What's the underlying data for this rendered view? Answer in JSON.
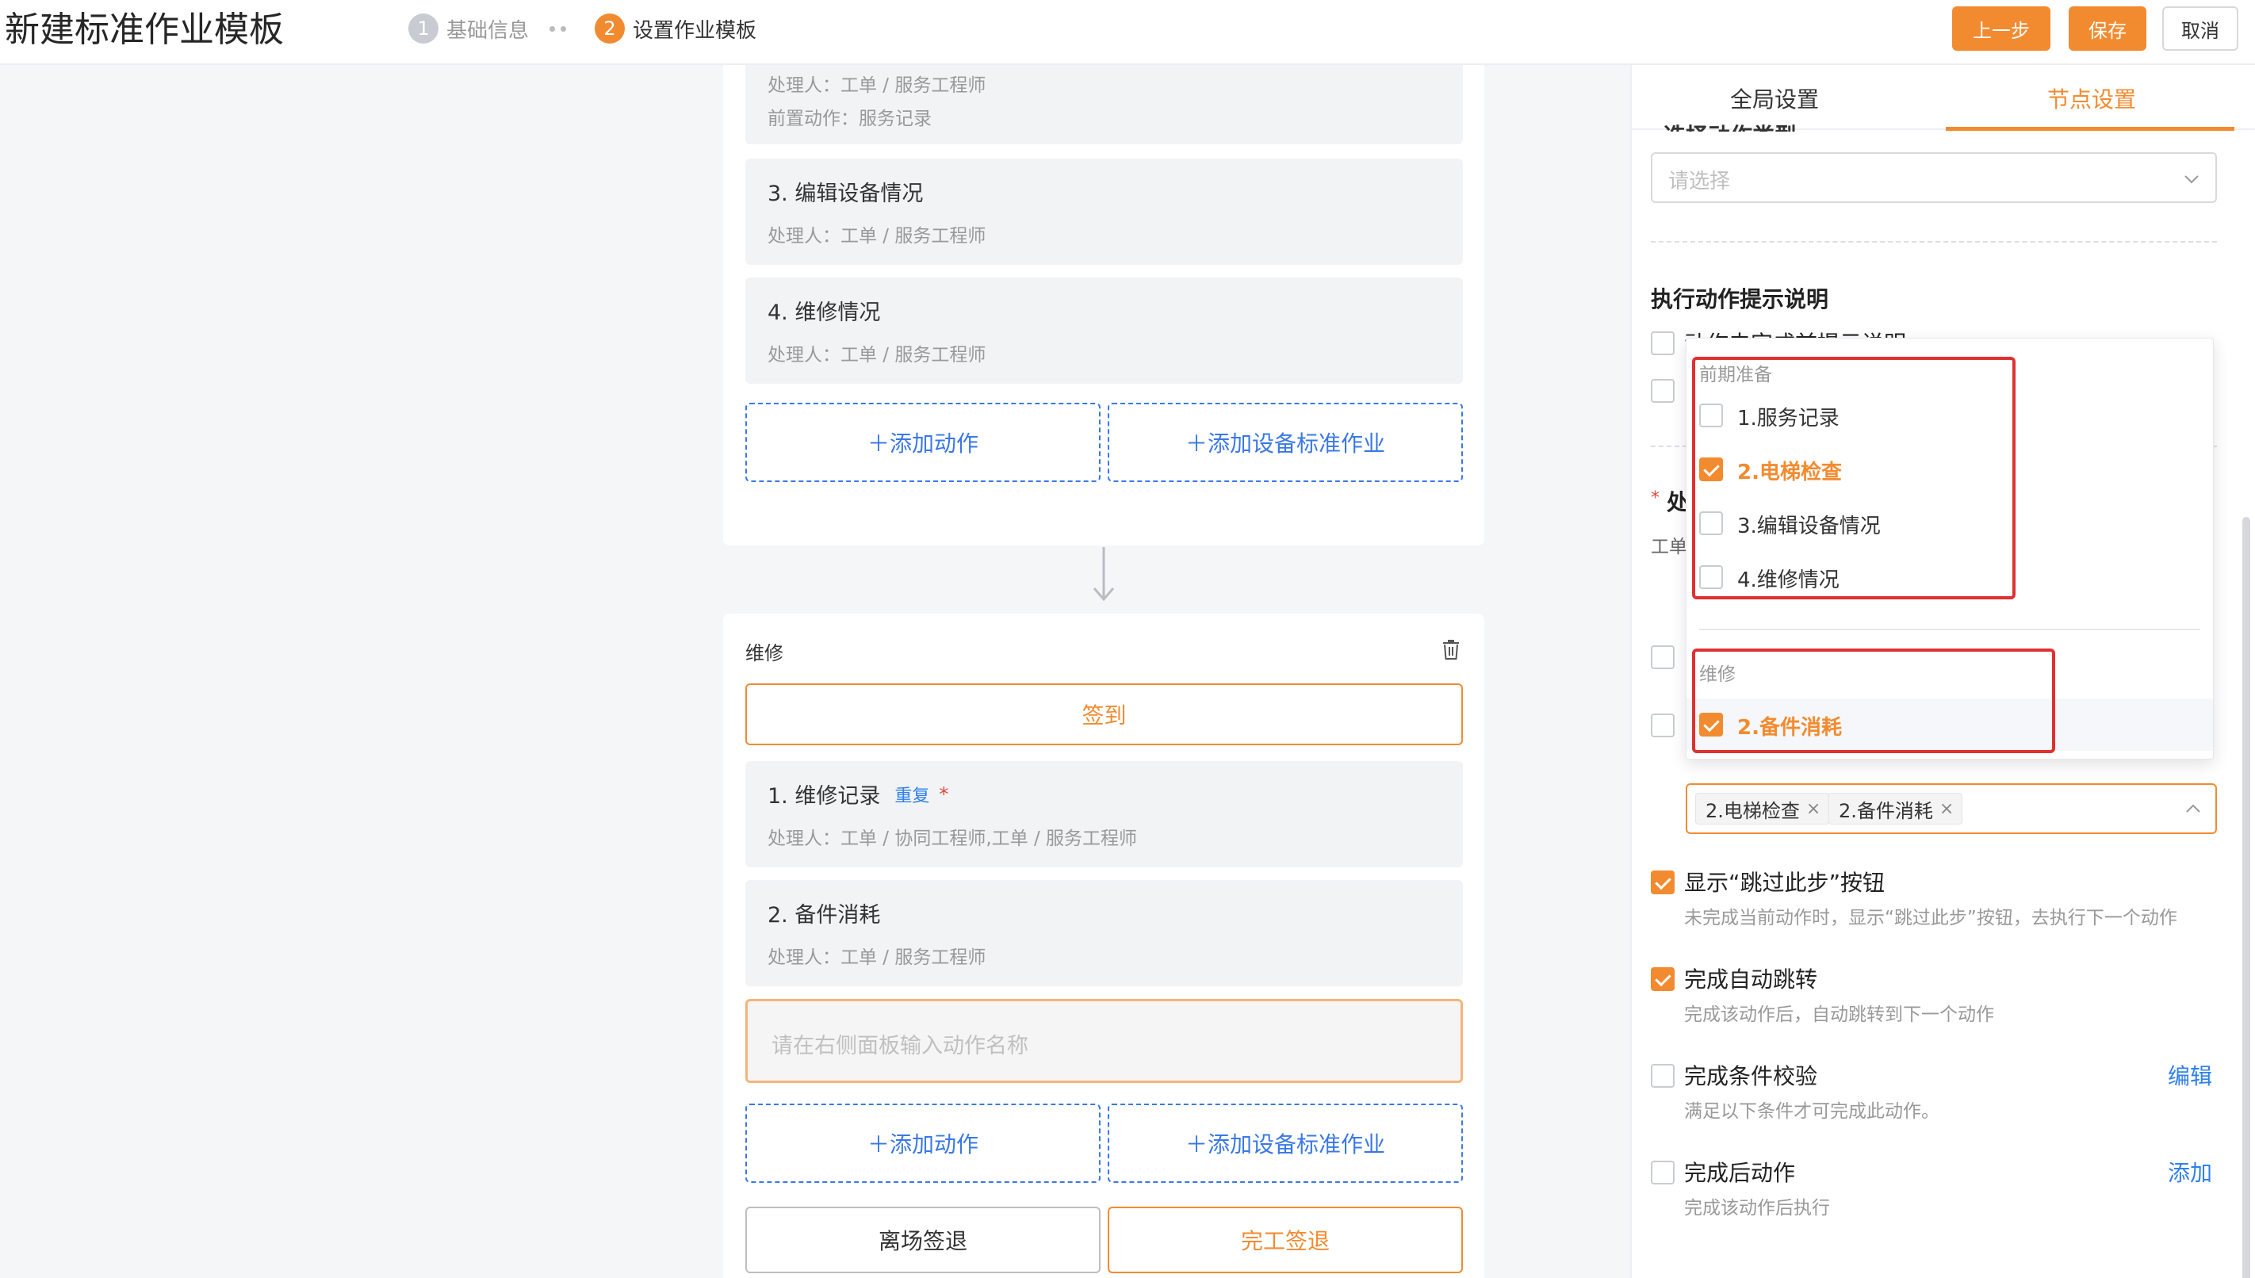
{
  "header": {
    "title": "新建标准作业模板",
    "steps": [
      {
        "num": "1",
        "label": "基础信息"
      },
      {
        "num": "2",
        "label": "设置作业模板"
      }
    ],
    "btn_prev": "上一步",
    "btn_save": "保存",
    "btn_cancel": "取消"
  },
  "flow": {
    "top_card": {
      "partial_action": {
        "handler": "处理人：工单 / 服务工程师",
        "pre_action": "前置动作：服务记录"
      },
      "actions": [
        {
          "title": "3. 编辑设备情况",
          "handler": "处理人：工单 / 服务工程师"
        },
        {
          "title": "4. 维修情况",
          "handler": "处理人：工单 / 服务工程师"
        }
      ],
      "add_action": "＋添加动作",
      "add_device": "＋添加设备标准作业"
    },
    "bottom_card": {
      "node_name": "维修",
      "checkin": "签到",
      "actions": [
        {
          "title": "1. 维修记录",
          "tag": "重复",
          "required": "*",
          "handler": "处理人：工单 / 协同工程师,工单 / 服务工程师"
        },
        {
          "title": "2. 备件消耗",
          "handler": "处理人：工单 / 服务工程师"
        }
      ],
      "new_action_placeholder": "请在右侧面板输入动作名称",
      "add_action": "＋添加动作",
      "add_device": "＋添加设备标准作业",
      "leave_checkout": "离场签退",
      "finish_checkout": "完工签退"
    }
  },
  "panel": {
    "tabs": [
      "全局设置",
      "节点设置"
    ],
    "active_tab": "节点设置",
    "cut_label": "选择动作类型",
    "select_placeholder": "请选择",
    "exec_tip_title": "执行动作提示说明",
    "hidden_frag1": "动作未完成前提示说明",
    "handler_frag": "处",
    "handler_star": "*",
    "handler_value_frag": "工单",
    "selected_chips": [
      "2.电梯检查",
      "2.备件消耗"
    ],
    "chip_close": "×",
    "options": [
      {
        "title": "显示“跳过此步”按钮",
        "desc": "未完成当前动作时，显示“跳过此步”按钮，去执行下一个动作",
        "checked": true
      },
      {
        "title": "完成自动跳转",
        "desc": "完成该动作后，自动跳转到下一个动作",
        "checked": true
      },
      {
        "title": "完成条件校验",
        "desc": "满足以下条件才可完成此动作。",
        "link": "编辑",
        "checked": false
      },
      {
        "title": "完成后动作",
        "desc": "完成该动作后执行",
        "link": "添加",
        "checked": false
      }
    ]
  },
  "dropdown": {
    "groups": [
      {
        "name": "前期准备",
        "items": [
          {
            "label": "1.服务记录",
            "checked": false
          },
          {
            "label": "2.电梯检查",
            "checked": true
          },
          {
            "label": "3.编辑设备情况",
            "checked": false
          },
          {
            "label": "4.维修情况",
            "checked": false
          }
        ]
      },
      {
        "name": "维修",
        "items": [
          {
            "label": "2.备件消耗",
            "checked": true
          }
        ]
      }
    ]
  },
  "colors": {
    "accent": "#f28b30",
    "link": "#2f80ed",
    "annotation": "#e03030"
  }
}
